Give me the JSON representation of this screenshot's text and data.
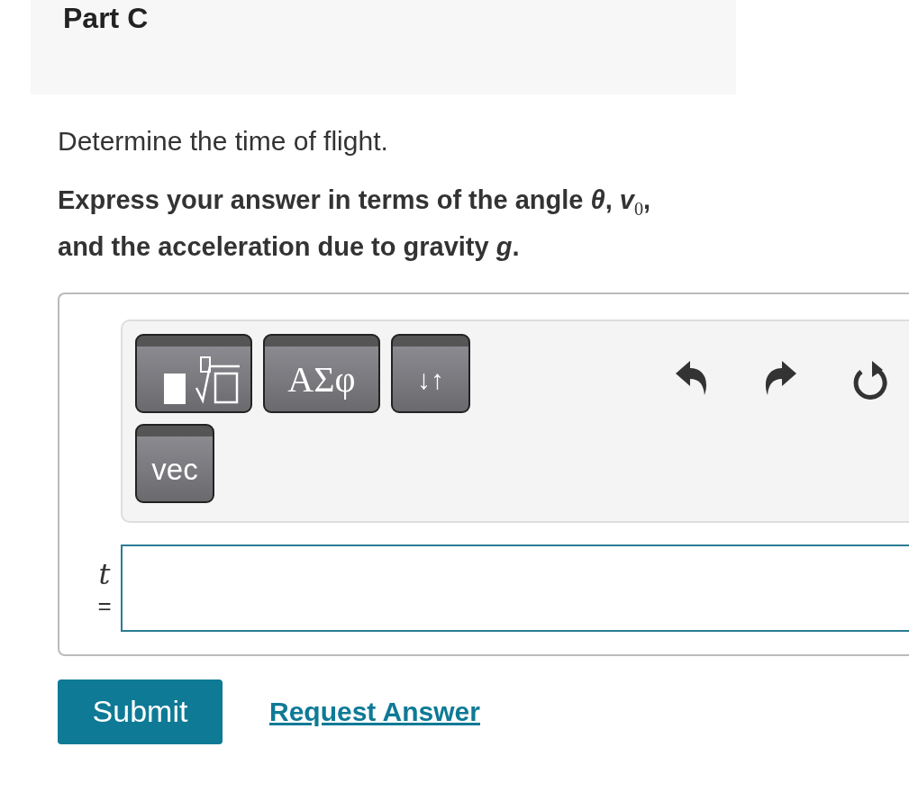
{
  "part": {
    "title": "Part C"
  },
  "question": {
    "prompt": "Determine the time of flight.",
    "instruction": "Express your answer in terms of the angle *θ*, *v*$_{0}$,\nand the acceleration due to gravity *g*."
  },
  "toolbar": {
    "buttons": [
      {
        "kind": "templates"
      },
      {
        "kind": "greek",
        "label": "ΑΣφ"
      },
      {
        "kind": "arrows",
        "label": "↓↑"
      },
      {
        "kind": "vector",
        "label": "vec"
      }
    ],
    "actions": [
      {
        "kind": "undo"
      },
      {
        "kind": "redo"
      },
      {
        "kind": "reset"
      }
    ]
  },
  "answer": {
    "variable": "t",
    "equals": "="
  },
  "buttons": {
    "submit": "Submit",
    "request": "Request Answer"
  }
}
